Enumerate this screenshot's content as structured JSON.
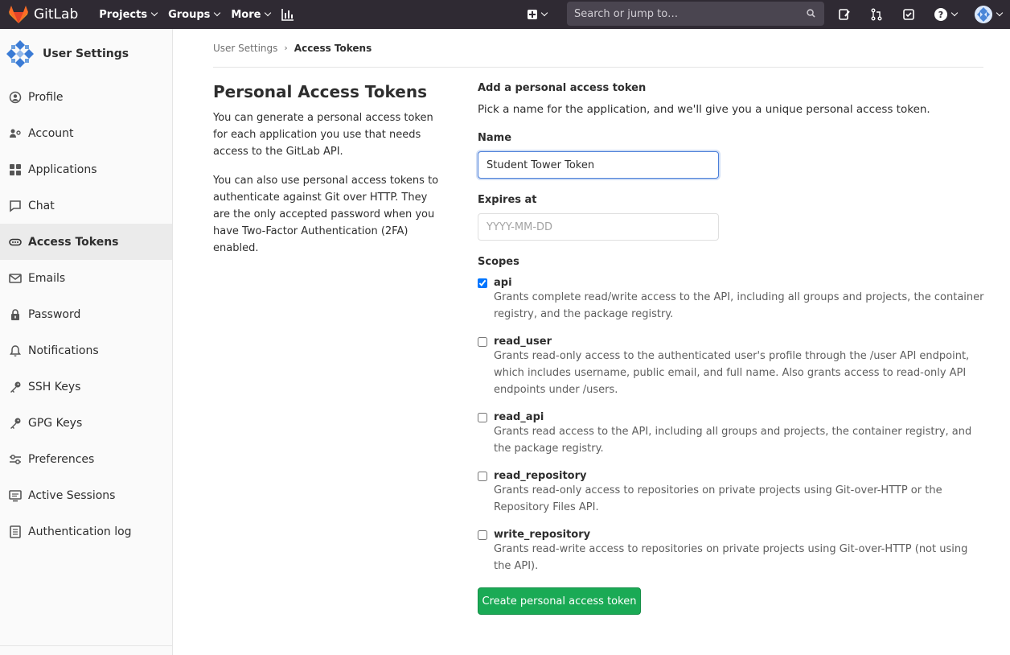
{
  "navbar": {
    "brand": "GitLab",
    "links": [
      "Projects",
      "Groups",
      "More"
    ],
    "search_placeholder": "Search or jump to…",
    "brand_color": "#fc6d26",
    "bg_color": "#2f2a33"
  },
  "sidebar": {
    "title": "User Settings",
    "items": [
      {
        "label": "Profile",
        "icon": "profile-icon"
      },
      {
        "label": "Account",
        "icon": "account-icon"
      },
      {
        "label": "Applications",
        "icon": "applications-icon"
      },
      {
        "label": "Chat",
        "icon": "chat-icon"
      },
      {
        "label": "Access Tokens",
        "icon": "token-icon",
        "active": true
      },
      {
        "label": "Emails",
        "icon": "email-icon"
      },
      {
        "label": "Password",
        "icon": "lock-icon"
      },
      {
        "label": "Notifications",
        "icon": "bell-icon"
      },
      {
        "label": "SSH Keys",
        "icon": "key-icon"
      },
      {
        "label": "GPG Keys",
        "icon": "key-icon"
      },
      {
        "label": "Preferences",
        "icon": "preferences-icon"
      },
      {
        "label": "Active Sessions",
        "icon": "monitor-icon"
      },
      {
        "label": "Authentication log",
        "icon": "log-icon"
      }
    ]
  },
  "breadcrumb": {
    "parent": "User Settings",
    "current": "Access Tokens"
  },
  "intro": {
    "title": "Personal Access Tokens",
    "p1": "You can generate a personal access token for each application you use that needs access to the GitLab API.",
    "p2": "You can also use personal access tokens to authenticate against Git over HTTP. They are the only accepted password when you have Two-Factor Authentication (2FA) enabled."
  },
  "form": {
    "section_title": "Add a personal access token",
    "section_desc": "Pick a name for the application, and we'll give you a unique personal access token.",
    "name_label": "Name",
    "name_value": "Student Tower Token",
    "expires_label": "Expires at",
    "expires_placeholder": "YYYY-MM-DD",
    "scopes_label": "Scopes",
    "scopes": [
      {
        "name": "api",
        "checked": true,
        "desc": "Grants complete read/write access to the API, including all groups and projects, the container registry, and the package registry."
      },
      {
        "name": "read_user",
        "checked": false,
        "desc": "Grants read-only access to the authenticated user's profile through the /user API endpoint, which includes username, public email, and full name. Also grants access to read-only API endpoints under /users."
      },
      {
        "name": "read_api",
        "checked": false,
        "desc": "Grants read access to the API, including all groups and projects, the container registry, and the package registry."
      },
      {
        "name": "read_repository",
        "checked": false,
        "desc": "Grants read-only access to repositories on private projects using Git-over-HTTP or the Repository Files API."
      },
      {
        "name": "write_repository",
        "checked": false,
        "desc": "Grants read-write access to repositories on private projects using Git-over-HTTP (not using the API)."
      }
    ],
    "submit_label": "Create personal access token",
    "submit_color": "#1aaa55"
  }
}
